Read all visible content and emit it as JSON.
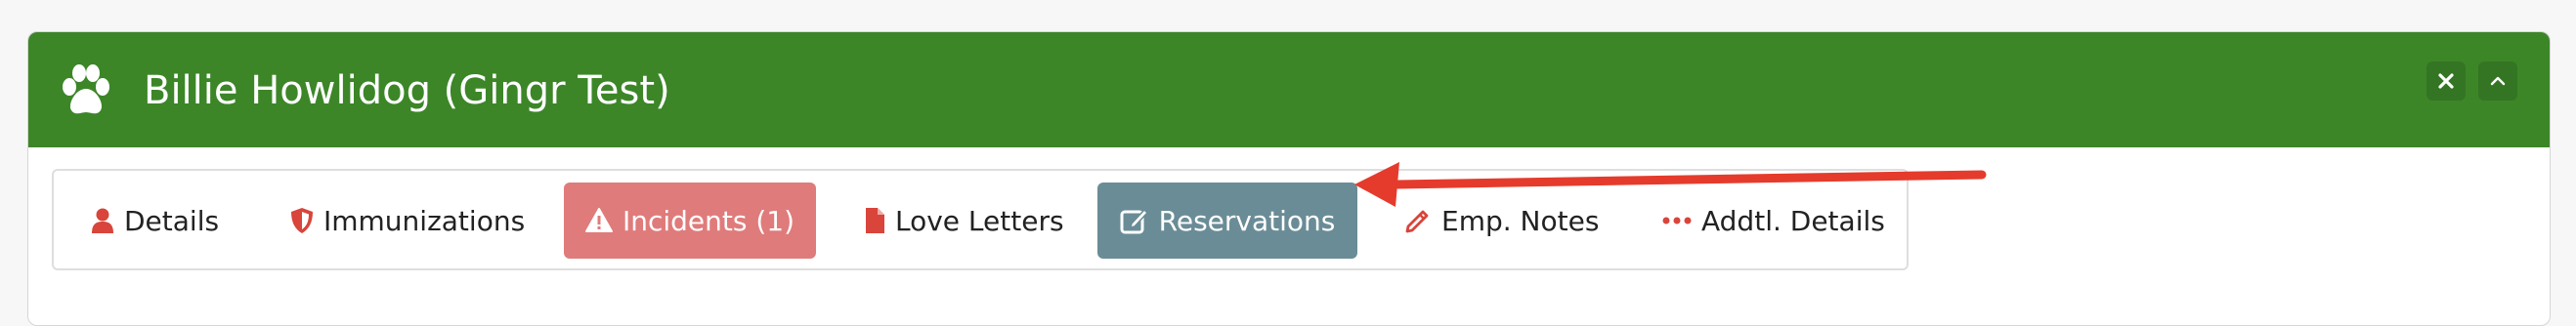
{
  "header": {
    "title": "Billie Howlidog (Gingr Test)",
    "icon": "paw-icon",
    "bg_color": "#3c8628",
    "close_icon": "close-icon",
    "collapse_icon": "chevron-up-icon"
  },
  "tabs": [
    {
      "label": "Details",
      "icon": "user-icon"
    },
    {
      "label": "Immunizations",
      "icon": "shield-icon"
    },
    {
      "label": "Incidents (1)",
      "icon": "warning-icon",
      "bg_color": "#e07b7b"
    },
    {
      "label": "Love Letters",
      "icon": "file-icon"
    },
    {
      "label": "Reservations",
      "icon": "edit-icon",
      "bg_color": "#6a8c96"
    },
    {
      "label": "Emp. Notes",
      "icon": "pencil-icon"
    },
    {
      "label": "Addtl. Details",
      "icon": "ellipsis-icon"
    }
  ],
  "annotation": {
    "color": "#e53b2c"
  }
}
